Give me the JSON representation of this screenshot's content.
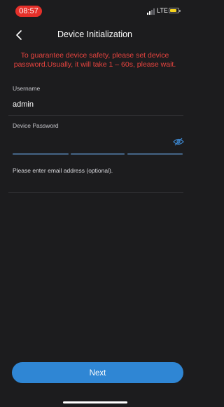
{
  "status_bar": {
    "time": "08:57",
    "network": "LTE",
    "time_pill_color": "#e5302a",
    "battery_color": "#f5d21e",
    "icons": [
      "signal-icon",
      "battery-icon"
    ]
  },
  "header": {
    "back_icon": "chevron-left-icon",
    "title": "Device Initialization"
  },
  "warning": {
    "text": "To guarantee device safety, please set device password.Usually, it will take 1 – 60s, please wait.",
    "color": "#e8443f"
  },
  "form": {
    "username_label": "Username",
    "username_value": "admin",
    "password_label": "Device Password",
    "password_value": "",
    "password_visibility_icon": "eye-icon",
    "password_strength_segments": 3,
    "email_prompt": "Please enter email address (optional)."
  },
  "footer": {
    "next_label": "Next",
    "next_color": "#2f86d4"
  }
}
